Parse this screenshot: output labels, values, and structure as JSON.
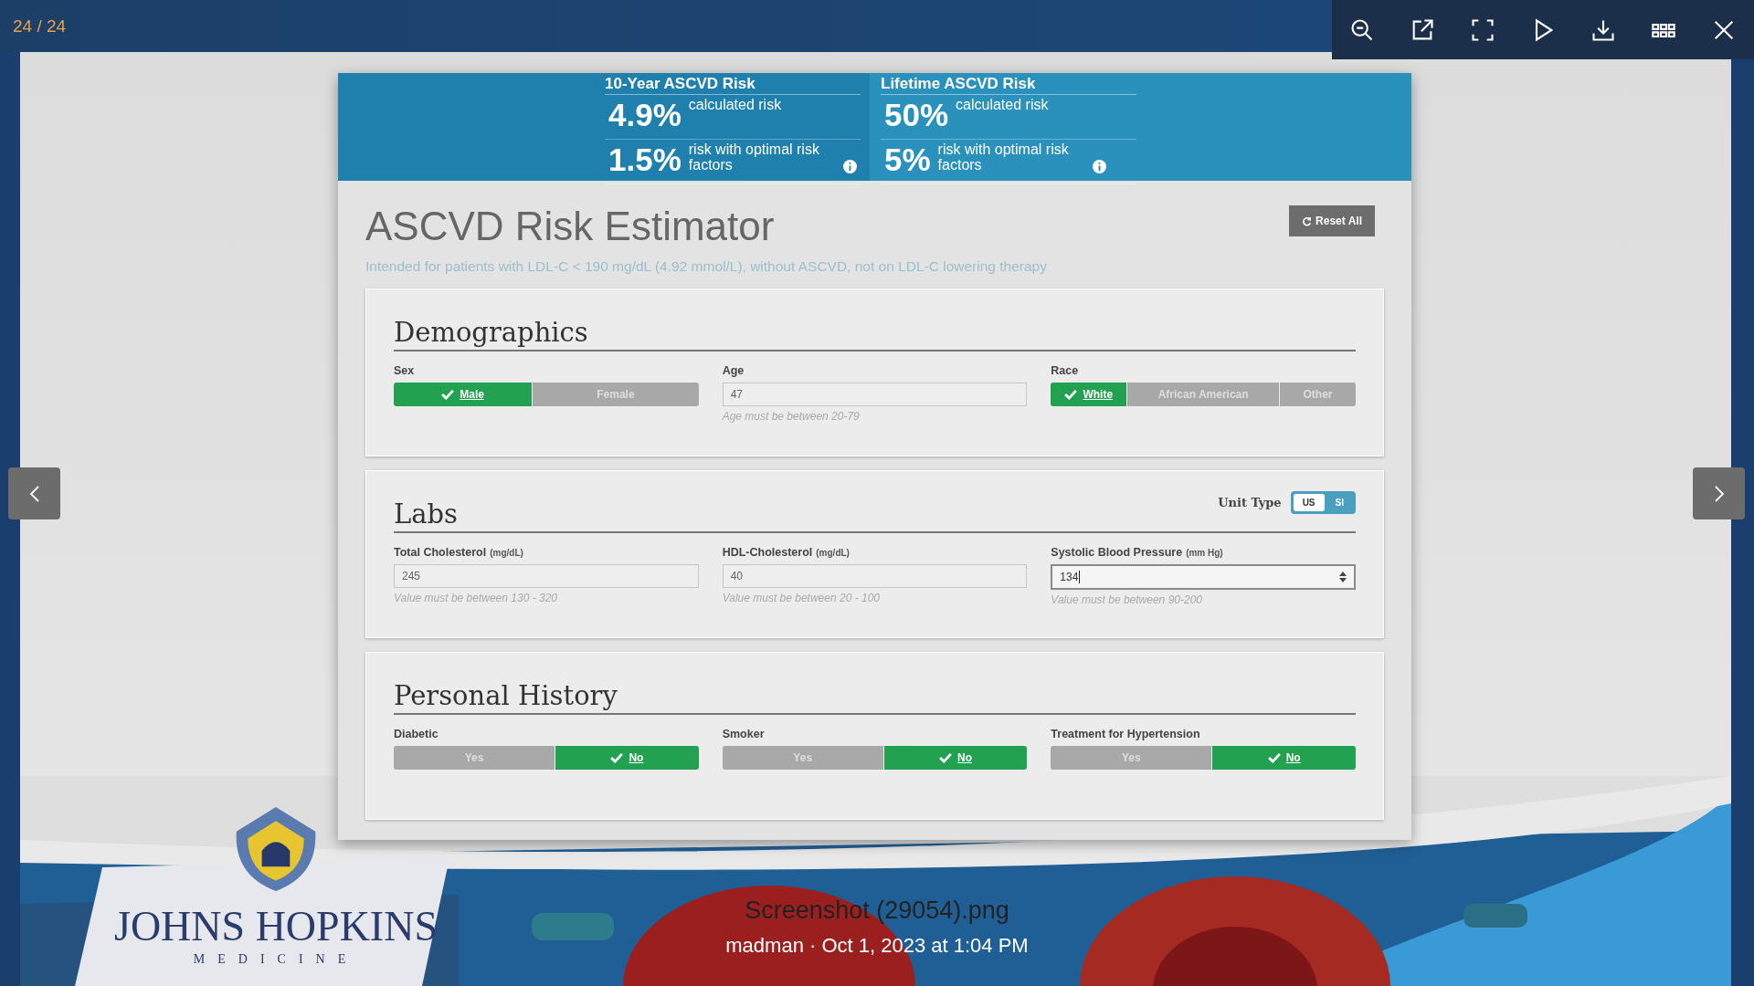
{
  "viewer": {
    "counter": "24 / 24",
    "caption": {
      "filename": "Screenshot (29054).png",
      "meta": "madman · Oct 1, 2023 at 1:04 PM"
    }
  },
  "slide": {
    "logo": {
      "name": "JOHNS HOPKINS",
      "sub": "MEDICINE"
    },
    "app": {
      "risks": [
        {
          "title": "10-Year ASCVD Risk",
          "rows": [
            {
              "value": "4.9%",
              "label": "calculated risk",
              "info": false
            },
            {
              "value": "1.5%",
              "label": "risk with optimal risk factors",
              "info": true
            }
          ]
        },
        {
          "title": "Lifetime ASCVD Risk",
          "rows": [
            {
              "value": "50%",
              "label": "calculated risk",
              "info": false
            },
            {
              "value": "5%",
              "label": "risk with optimal risk factors",
              "info": true
            }
          ]
        }
      ],
      "title": "ASCVD Risk Estimator",
      "subtitle": "Intended for patients with LDL-C < 190 mg/dL (4.92 mmol/L), without ASCVD, not on LDL-C lowering therapy",
      "reset_button": "Reset All",
      "sections": [
        {
          "title": "Demographics",
          "fields": [
            {
              "kind": "segmented",
              "label": "Sex",
              "options": [
                {
                  "label": "Male",
                  "selected": true
                },
                {
                  "label": "Female",
                  "selected": false
                }
              ]
            },
            {
              "kind": "input",
              "label": "Age",
              "value": "47",
              "hint": "Age must be between 20-79"
            },
            {
              "kind": "segmented",
              "label": "Race",
              "options": [
                {
                  "label": "White",
                  "selected": true
                },
                {
                  "label": "African American",
                  "selected": false
                },
                {
                  "label": "Other",
                  "selected": false
                }
              ]
            }
          ]
        },
        {
          "title": "Labs",
          "unit_toggle": {
            "label": "Unit Type",
            "options": [
              {
                "label": "US",
                "selected": true
              },
              {
                "label": "SI",
                "selected": false
              }
            ]
          },
          "fields": [
            {
              "kind": "input",
              "label": "Total Cholesterol",
              "unit": "(mg/dL)",
              "value": "245",
              "hint": "Value must be between 130 - 320"
            },
            {
              "kind": "input",
              "label": "HDL-Cholesterol",
              "unit": "(mg/dL)",
              "value": "40",
              "hint": "Value must be between 20 - 100"
            },
            {
              "kind": "spinner",
              "label": "Systolic Blood Pressure",
              "unit": "(mm Hg)",
              "value": "134",
              "hint": "Value must be between 90-200"
            }
          ]
        },
        {
          "title": "Personal History",
          "fields": [
            {
              "kind": "segmented",
              "label": "Diabetic",
              "options": [
                {
                  "label": "Yes",
                  "selected": false
                },
                {
                  "label": "No",
                  "selected": true
                }
              ]
            },
            {
              "kind": "segmented",
              "label": "Smoker",
              "options": [
                {
                  "label": "Yes",
                  "selected": false
                },
                {
                  "label": "No",
                  "selected": true
                }
              ]
            },
            {
              "kind": "segmented",
              "label": "Treatment for Hypertension",
              "options": [
                {
                  "label": "Yes",
                  "selected": false
                },
                {
                  "label": "No",
                  "selected": true
                }
              ]
            }
          ]
        }
      ]
    }
  }
}
